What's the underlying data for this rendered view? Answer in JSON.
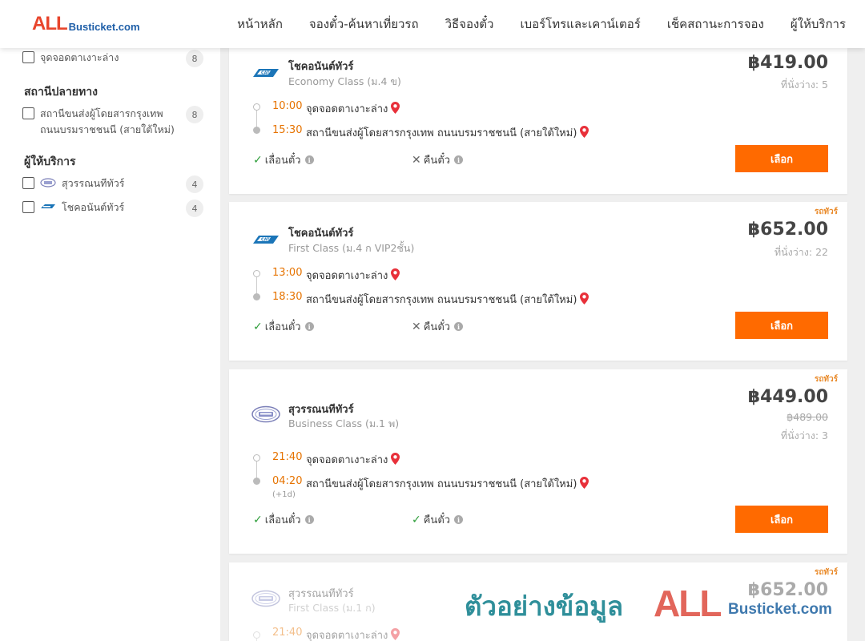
{
  "header": {
    "logo_all": "ALL",
    "logo_rest": "Busticket.com",
    "nav": [
      "หน้าหลัก",
      "จองตั๋ว-ค้นหาเที่ยวรถ",
      "วิธีจองตั๋ว",
      "เบอร์โทรและเคาน์เตอร์",
      "เช็คสถานะการจอง",
      "ผู้ให้บริการ"
    ]
  },
  "sidebar": {
    "origin_item": {
      "label": "จุดจอดตาเงาะล่าง",
      "count": "8"
    },
    "destination_title": "สถานีปลายทาง",
    "destination_item": {
      "label": "สถานีขนส่งผู้โดยสารกรุงเทพ ถนนบรมราชชนนี (สายใต้ใหม่)",
      "count": "8"
    },
    "operator_title": "ผู้ให้บริการ",
    "operators": [
      {
        "label": "สุวรรณนทีทัวร์",
        "count": "4"
      },
      {
        "label": "โชคอนันต์ทัวร์",
        "count": "4"
      }
    ]
  },
  "labels": {
    "change_ticket": "เลื่อนตั๋ว",
    "refund_ticket": "คืนตั๋ว",
    "select": "เลือก",
    "tag": "รถทัวร์",
    "plus1": "(+1d)"
  },
  "trips": [
    {
      "operator": "โชคอนันต์ทัวร์",
      "class": "Economy Class (ม.4 ข)",
      "price": "฿419.00",
      "seats": "ที่นั่งว่าง: 5",
      "dep_time": "10:00",
      "dep_place": "จุดจอดตาเงาะล่าง",
      "arr_time": "15:30",
      "arr_place": "สถานีขนส่งผู้โดยสารกรุงเทพ ถนนบรมราชชนนี (สายใต้ใหม่)"
    },
    {
      "tag": "รถทัวร์",
      "operator": "โชคอนันต์ทัวร์",
      "class": "First Class (ม.4 ก VIP2ชั้น)",
      "price": "฿652.00",
      "seats": "ที่นั่งว่าง: 22",
      "dep_time": "13:00",
      "dep_place": "จุดจอดตาเงาะล่าง",
      "arr_time": "18:30",
      "arr_place": "สถานีขนส่งผู้โดยสารกรุงเทพ ถนนบรมราชชนนี (สายใต้ใหม่)"
    },
    {
      "tag": "รถทัวร์",
      "operator": "สุวรรณนทีทัวร์",
      "class": "Business Class (ม.1 พ)",
      "price": "฿449.00",
      "old_price": "฿489.00",
      "seats": "ที่นั่งว่าง: 3",
      "dep_time": "21:40",
      "dep_place": "จุดจอดตาเงาะล่าง",
      "arr_time": "04:20",
      "arr_place": "สถานีขนส่งผู้โดยสารกรุงเทพ ถนนบรมราชชนนี (สายใต้ใหม่)"
    },
    {
      "tag": "รถทัวร์",
      "operator": "สุวรรณนทีทัวร์",
      "class": "First Class (ม.1 ก)",
      "price": "฿652.00",
      "dep_time": "21:40",
      "dep_place": "จุดจอดตาเงาะล่าง"
    }
  ],
  "watermark": {
    "text": "ตัวอย่างข้อมูล",
    "all": "ALL",
    "rest": "Busticket.com"
  },
  "colors": {
    "accent": "#ff6a00",
    "time": "#e67300",
    "pin": "#e8303a",
    "check": "#2e9e3a"
  }
}
